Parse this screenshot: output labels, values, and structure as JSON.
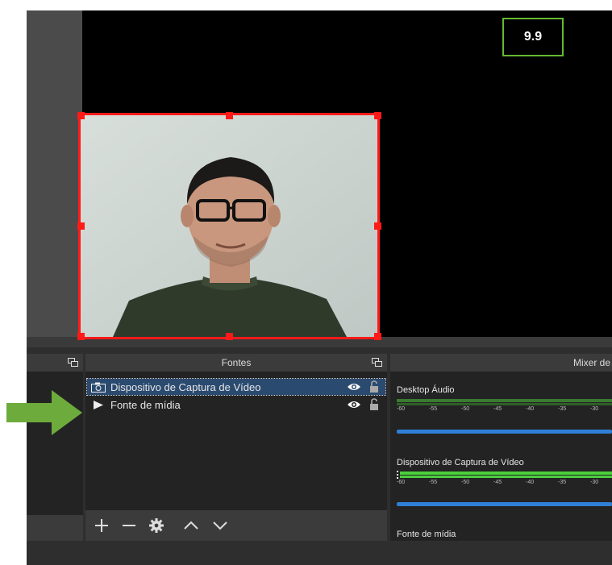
{
  "overlay": {
    "number_label": "9.9"
  },
  "sources_panel": {
    "title": "Fontes",
    "items": [
      {
        "label": "Dispositivo de Captura de Vídeo",
        "icon": "camera-icon",
        "selected": true
      },
      {
        "label": "Fonte de mídia",
        "icon": "play-icon",
        "selected": false
      }
    ],
    "toolbar": [
      "plus-icon",
      "minus-icon",
      "gear-icon",
      "chevron-up-icon",
      "chevron-down-icon"
    ]
  },
  "mixer_panel": {
    "title": "Mixer de",
    "channels": [
      {
        "name": "Desktop Áudio"
      },
      {
        "name": "Dispositivo de Captura de Vídeo"
      },
      {
        "name": "Fonte de mídia"
      }
    ],
    "scale": [
      "-60",
      "-55",
      "-50",
      "-45",
      "-40",
      "-35",
      "-30"
    ]
  },
  "colors": {
    "selection": "#ff1a1a",
    "accent": "#64b832",
    "slider": "#2f7fd6",
    "meter": "#4ccf3d"
  }
}
